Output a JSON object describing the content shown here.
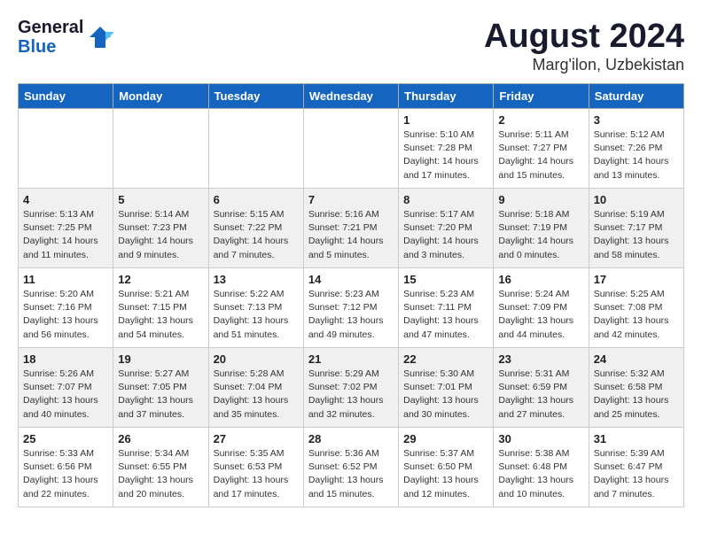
{
  "header": {
    "logo_line1": "General",
    "logo_line2": "Blue",
    "title": "August 2024",
    "subtitle": "Marg'ilon, Uzbekistan"
  },
  "days_of_week": [
    "Sunday",
    "Monday",
    "Tuesday",
    "Wednesday",
    "Thursday",
    "Friday",
    "Saturday"
  ],
  "weeks": [
    [
      {
        "day": "",
        "info": ""
      },
      {
        "day": "",
        "info": ""
      },
      {
        "day": "",
        "info": ""
      },
      {
        "day": "",
        "info": ""
      },
      {
        "day": "1",
        "info": "Sunrise: 5:10 AM\nSunset: 7:28 PM\nDaylight: 14 hours\nand 17 minutes."
      },
      {
        "day": "2",
        "info": "Sunrise: 5:11 AM\nSunset: 7:27 PM\nDaylight: 14 hours\nand 15 minutes."
      },
      {
        "day": "3",
        "info": "Sunrise: 5:12 AM\nSunset: 7:26 PM\nDaylight: 14 hours\nand 13 minutes."
      }
    ],
    [
      {
        "day": "4",
        "info": "Sunrise: 5:13 AM\nSunset: 7:25 PM\nDaylight: 14 hours\nand 11 minutes."
      },
      {
        "day": "5",
        "info": "Sunrise: 5:14 AM\nSunset: 7:23 PM\nDaylight: 14 hours\nand 9 minutes."
      },
      {
        "day": "6",
        "info": "Sunrise: 5:15 AM\nSunset: 7:22 PM\nDaylight: 14 hours\nand 7 minutes."
      },
      {
        "day": "7",
        "info": "Sunrise: 5:16 AM\nSunset: 7:21 PM\nDaylight: 14 hours\nand 5 minutes."
      },
      {
        "day": "8",
        "info": "Sunrise: 5:17 AM\nSunset: 7:20 PM\nDaylight: 14 hours\nand 3 minutes."
      },
      {
        "day": "9",
        "info": "Sunrise: 5:18 AM\nSunset: 7:19 PM\nDaylight: 14 hours\nand 0 minutes."
      },
      {
        "day": "10",
        "info": "Sunrise: 5:19 AM\nSunset: 7:17 PM\nDaylight: 13 hours\nand 58 minutes."
      }
    ],
    [
      {
        "day": "11",
        "info": "Sunrise: 5:20 AM\nSunset: 7:16 PM\nDaylight: 13 hours\nand 56 minutes."
      },
      {
        "day": "12",
        "info": "Sunrise: 5:21 AM\nSunset: 7:15 PM\nDaylight: 13 hours\nand 54 minutes."
      },
      {
        "day": "13",
        "info": "Sunrise: 5:22 AM\nSunset: 7:13 PM\nDaylight: 13 hours\nand 51 minutes."
      },
      {
        "day": "14",
        "info": "Sunrise: 5:23 AM\nSunset: 7:12 PM\nDaylight: 13 hours\nand 49 minutes."
      },
      {
        "day": "15",
        "info": "Sunrise: 5:23 AM\nSunset: 7:11 PM\nDaylight: 13 hours\nand 47 minutes."
      },
      {
        "day": "16",
        "info": "Sunrise: 5:24 AM\nSunset: 7:09 PM\nDaylight: 13 hours\nand 44 minutes."
      },
      {
        "day": "17",
        "info": "Sunrise: 5:25 AM\nSunset: 7:08 PM\nDaylight: 13 hours\nand 42 minutes."
      }
    ],
    [
      {
        "day": "18",
        "info": "Sunrise: 5:26 AM\nSunset: 7:07 PM\nDaylight: 13 hours\nand 40 minutes."
      },
      {
        "day": "19",
        "info": "Sunrise: 5:27 AM\nSunset: 7:05 PM\nDaylight: 13 hours\nand 37 minutes."
      },
      {
        "day": "20",
        "info": "Sunrise: 5:28 AM\nSunset: 7:04 PM\nDaylight: 13 hours\nand 35 minutes."
      },
      {
        "day": "21",
        "info": "Sunrise: 5:29 AM\nSunset: 7:02 PM\nDaylight: 13 hours\nand 32 minutes."
      },
      {
        "day": "22",
        "info": "Sunrise: 5:30 AM\nSunset: 7:01 PM\nDaylight: 13 hours\nand 30 minutes."
      },
      {
        "day": "23",
        "info": "Sunrise: 5:31 AM\nSunset: 6:59 PM\nDaylight: 13 hours\nand 27 minutes."
      },
      {
        "day": "24",
        "info": "Sunrise: 5:32 AM\nSunset: 6:58 PM\nDaylight: 13 hours\nand 25 minutes."
      }
    ],
    [
      {
        "day": "25",
        "info": "Sunrise: 5:33 AM\nSunset: 6:56 PM\nDaylight: 13 hours\nand 22 minutes."
      },
      {
        "day": "26",
        "info": "Sunrise: 5:34 AM\nSunset: 6:55 PM\nDaylight: 13 hours\nand 20 minutes."
      },
      {
        "day": "27",
        "info": "Sunrise: 5:35 AM\nSunset: 6:53 PM\nDaylight: 13 hours\nand 17 minutes."
      },
      {
        "day": "28",
        "info": "Sunrise: 5:36 AM\nSunset: 6:52 PM\nDaylight: 13 hours\nand 15 minutes."
      },
      {
        "day": "29",
        "info": "Sunrise: 5:37 AM\nSunset: 6:50 PM\nDaylight: 13 hours\nand 12 minutes."
      },
      {
        "day": "30",
        "info": "Sunrise: 5:38 AM\nSunset: 6:48 PM\nDaylight: 13 hours\nand 10 minutes."
      },
      {
        "day": "31",
        "info": "Sunrise: 5:39 AM\nSunset: 6:47 PM\nDaylight: 13 hours\nand 7 minutes."
      }
    ]
  ]
}
